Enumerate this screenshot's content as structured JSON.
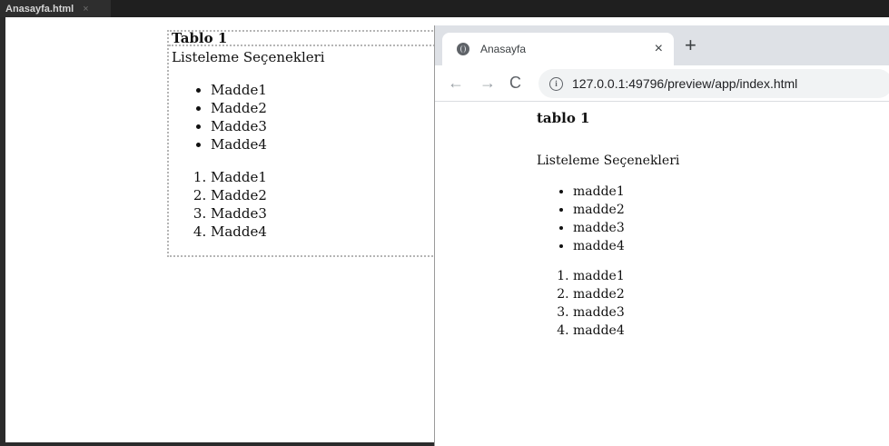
{
  "editor": {
    "tab": {
      "title": "Anasayfa.html",
      "close": "×"
    },
    "design": {
      "title": "Tablo 1",
      "subtitle": "Listeleme Seçenekleri",
      "bullets": [
        "Madde1",
        "Madde2",
        "Madde3",
        "Madde4"
      ],
      "numbered": [
        "Madde1",
        "Madde2",
        "Madde3",
        "Madde4"
      ]
    }
  },
  "browser": {
    "tab": {
      "title": "Anasayfa",
      "icon": "globe-icon",
      "close": "×"
    },
    "new_tab": "+",
    "nav": {
      "back": "←",
      "forward": "→",
      "reload": "C"
    },
    "address": {
      "icon": "info-icon",
      "url": "127.0.0.1:49796/preview/app/index.html"
    },
    "page": {
      "heading": "tablo 1",
      "subtitle": "Listeleme Seçenekleri",
      "bullets": [
        "madde1",
        "madde2",
        "madde3",
        "madde4"
      ],
      "numbered": [
        "madde1",
        "madde2",
        "madde3",
        "madde4"
      ]
    }
  },
  "colors": {
    "editor_chrome": "#1f1f1f",
    "browser_tabstrip": "#dee1e6",
    "omnibox_bg": "#f1f3f4"
  }
}
